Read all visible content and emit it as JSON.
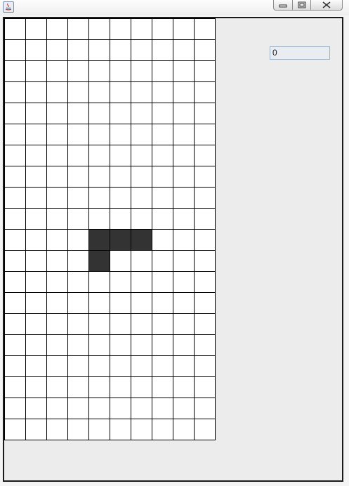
{
  "window": {
    "title": "",
    "controls": {
      "minimize_icon": "minimize-icon",
      "maximize_icon": "maximize-icon",
      "close_icon": "close-icon"
    }
  },
  "board": {
    "columns": 10,
    "rows": 20,
    "empty_color": "#ffffff",
    "grid_color": "#000000",
    "filled_color": "#333333",
    "filled_cells": [
      [
        10,
        4
      ],
      [
        10,
        5
      ],
      [
        10,
        6
      ],
      [
        11,
        4
      ]
    ]
  },
  "score": {
    "value": "0"
  },
  "colors": {
    "panel_background": "#ececec",
    "field_border": "#9fb3c8"
  }
}
